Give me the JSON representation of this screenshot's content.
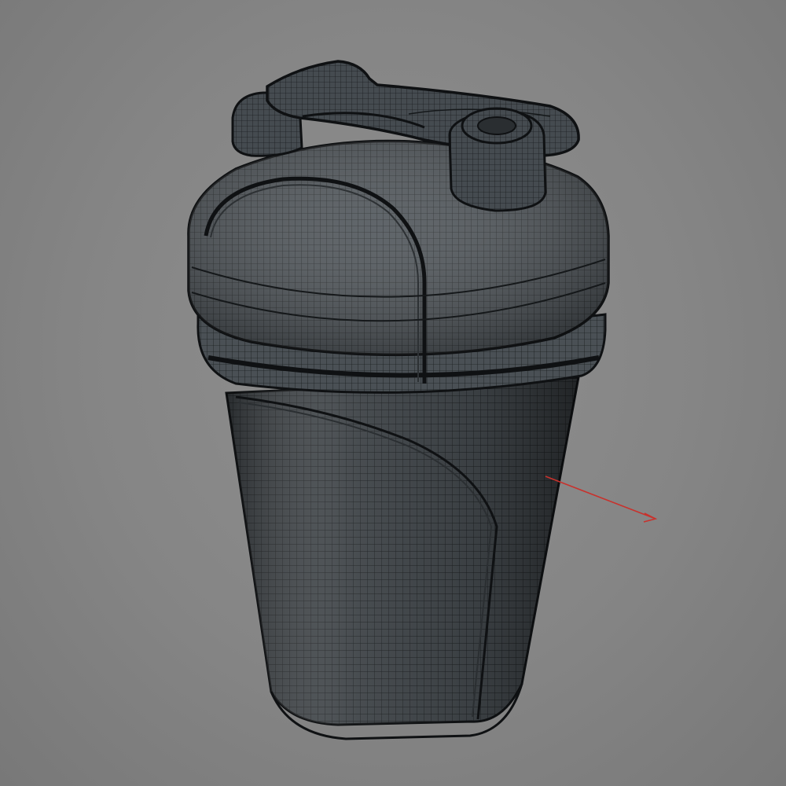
{
  "viewport": {
    "background_color": "#858585",
    "object_name": "shaker-bottle",
    "display_mode": "wireframe-on-shaded",
    "mesh_fill_color": "#3e4347",
    "mesh_edge_color": "#1c1f21",
    "wire_color": "#0f1113"
  },
  "axis_gizmo": {
    "axis": "x",
    "color": "#c8322d"
  },
  "visible_parts": [
    "cup-body",
    "lid",
    "flip-cap",
    "spout",
    "hinge"
  ]
}
